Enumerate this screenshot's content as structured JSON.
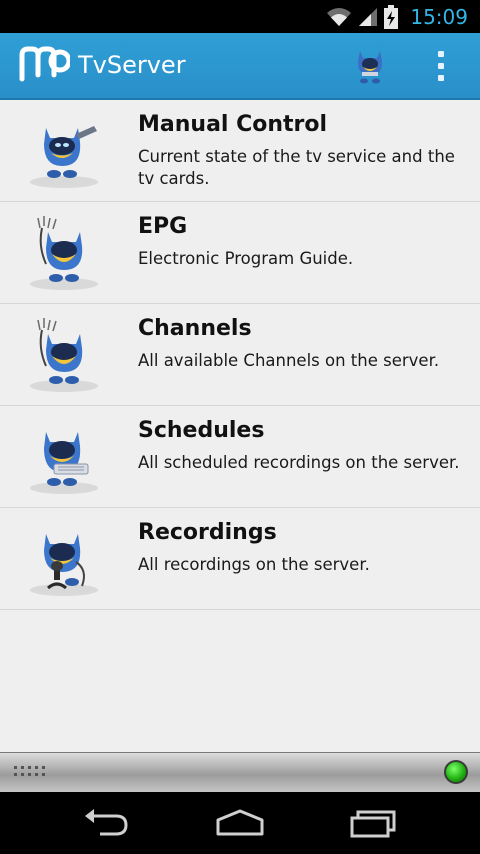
{
  "status_bar": {
    "time": "15:09",
    "icons": [
      "wifi-icon",
      "signal-icon",
      "battery-charging-icon"
    ]
  },
  "action_bar": {
    "title": "TvServer",
    "icons": [
      "mediaportal-logo-icon",
      "mascot-icon",
      "overflow-menu-icon"
    ]
  },
  "menu": {
    "items": [
      {
        "title": "Manual Control",
        "description": "Current state of the tv service and the tv cards.",
        "icon": "mascot-remote-icon"
      },
      {
        "title": "EPG",
        "description": "Electronic Program Guide.",
        "icon": "mascot-antenna-icon"
      },
      {
        "title": "Channels",
        "description": "All available Channels on the server.",
        "icon": "mascot-antenna-icon"
      },
      {
        "title": "Schedules",
        "description": "All scheduled recordings on the server.",
        "icon": "mascot-keyboard-icon"
      },
      {
        "title": "Recordings",
        "description": "All recordings on the server.",
        "icon": "mascot-microphone-icon"
      }
    ]
  },
  "bottom_bar": {
    "icons": [
      "grip-icon",
      "connection-status-icon"
    ],
    "connection_color": "#22b312"
  },
  "nav_bar": {
    "icons": [
      "back-icon",
      "home-icon",
      "recent-apps-icon"
    ]
  },
  "colors": {
    "accent": "#33b5e5",
    "action_bar": "#2a8fc9"
  }
}
